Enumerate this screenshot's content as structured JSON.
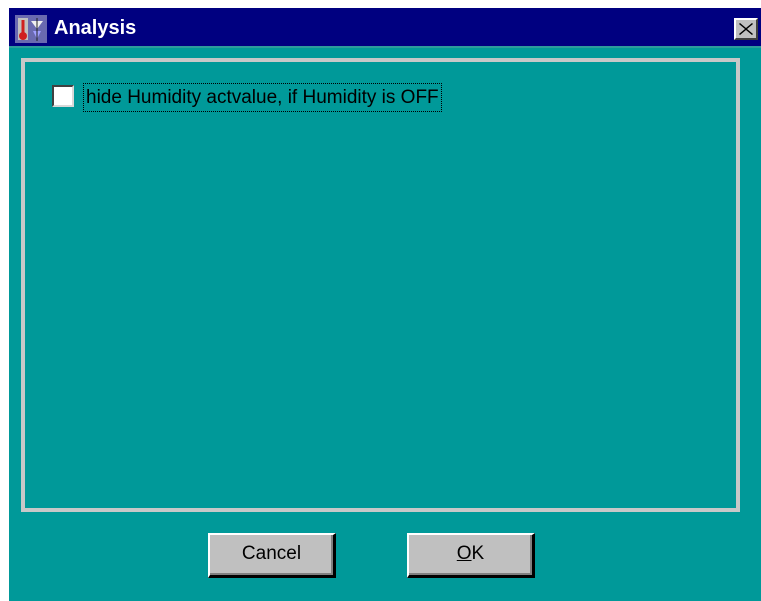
{
  "window": {
    "title": "Analysis",
    "app_icon": "weather-station-icon",
    "close_icon": "close-icon"
  },
  "options": {
    "hide_humidity_label": "hide Humidity actvalue, if Humidity is OFF",
    "hide_humidity_checked": false
  },
  "buttons": {
    "cancel_label": "Cancel",
    "ok_mnemonic": "O",
    "ok_rest": "K"
  },
  "colors": {
    "titlebar": "#000080",
    "dialog_background": "#009999",
    "button_face": "#c0c0c0",
    "frame": "#c8c8c8"
  }
}
